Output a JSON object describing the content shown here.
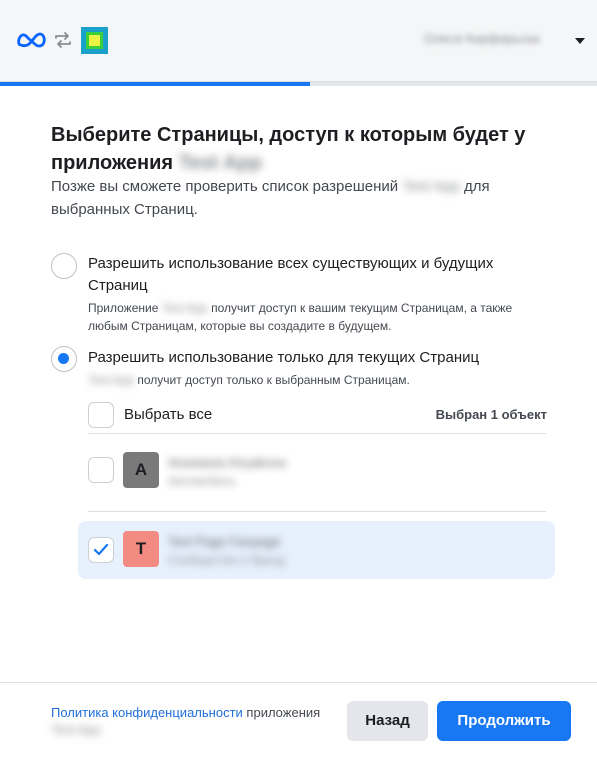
{
  "header": {
    "account_name": "Олеся Кирфирьска",
    "icons": [
      "meta-logo",
      "swap-arrows-icon",
      "app-icon"
    ]
  },
  "progress": {
    "fraction": 0.52
  },
  "title": {
    "text": "Выберите Страницы, доступ к которым будет у приложения",
    "app_name": "Test App"
  },
  "subtitle": {
    "before": "Позже вы сможете проверить список разрешений",
    "app_name": "Test App",
    "after": "для выбранных Страниц."
  },
  "options": [
    {
      "label": "Разрешить использование всех существующих и будущих Страниц",
      "desc_before": "Приложение",
      "desc_app": "Test App",
      "desc_after": "получит доступ к вашим текущим Страницам, а также любым Страницам, которые вы создадите в будущем.",
      "selected": false
    },
    {
      "label": "Разрешить использование только для текущих Страниц",
      "desc_app": "Test App",
      "desc_after": "получит доступ только к выбранным Страницам.",
      "selected": true
    }
  ],
  "select_all": {
    "label": "Выбрать все",
    "count_text": "Выбран 1 объект"
  },
  "pages": [
    {
      "initial": "A",
      "name": "Anastasia Kiryakova",
      "sub": "Автомобиль",
      "checked": false,
      "color": "#7a7a7a"
    },
    {
      "initial": "T",
      "name": "Test Page Fanpage",
      "sub": "Сообщество и бренд",
      "checked": true,
      "color": "#f28b82"
    }
  ],
  "footer": {
    "policy_link": "Политика конфиденциальности",
    "policy_suffix": "приложения",
    "app_name": "Test App",
    "back_label": "Назад",
    "continue_label": "Продолжить"
  },
  "colors": {
    "accent": "#1877f2",
    "selected_row": "#e7f0fd"
  }
}
